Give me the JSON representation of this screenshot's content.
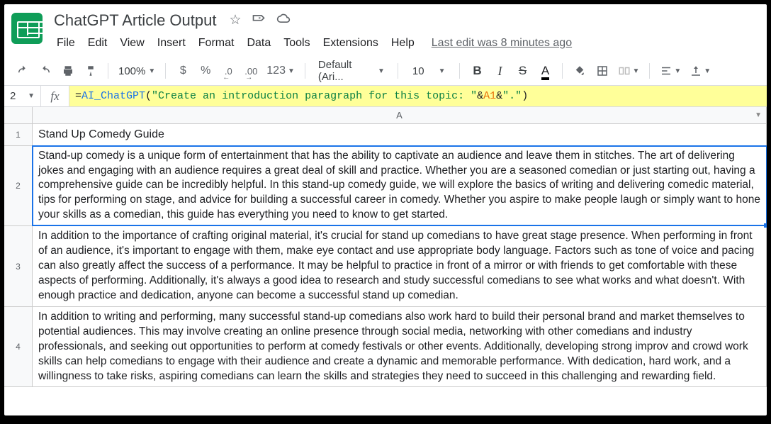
{
  "doc": {
    "title": "ChatGPT Article Output",
    "last_edit": "Last edit was 8 minutes ago"
  },
  "menu": {
    "file": "File",
    "edit": "Edit",
    "view": "View",
    "insert": "Insert",
    "format": "Format",
    "data": "Data",
    "tools": "Tools",
    "extensions": "Extensions",
    "help": "Help"
  },
  "toolbar": {
    "zoom": "100%",
    "currency": "$",
    "percent": "%",
    "dec_dec": ".0",
    "dec_inc": ".00",
    "more_formats": "123",
    "font": "Default (Ari...",
    "font_size": "10",
    "bold": "B",
    "italic": "I",
    "strike": "S",
    "text_color": "A"
  },
  "formula": {
    "name_box": "2",
    "fx": "fx",
    "eq": "=",
    "func": "AI_ChatGPT",
    "open": "(",
    "str1": "\"Create an introduction paragraph for this topic: \"",
    "amp1": "&",
    "ref": "A1",
    "amp2": "&",
    "str2": "\".\"",
    "close": ")"
  },
  "sheet": {
    "col_a": "A",
    "rows": {
      "r1": "1",
      "r2": "2",
      "r3": "3",
      "r4": "4"
    },
    "cells": {
      "a1": "Stand Up Comedy Guide",
      "a2": "Stand-up comedy is a unique form of entertainment that has the ability to captivate an audience and leave them in stitches. The art of delivering jokes and engaging with an audience requires a great deal of skill and practice. Whether you are a seasoned comedian or just starting out, having a comprehensive guide can be incredibly helpful. In this stand-up comedy guide, we will explore the basics of writing and delivering comedic material, tips for performing on stage, and advice for building a successful career in comedy. Whether you aspire to make people laugh or simply want to hone your skills as a comedian, this guide has everything you need to know to get started.",
      "a3": "In addition to the importance of crafting original material, it's crucial for stand up comedians to have great stage presence. When performing in front of an audience, it's important to engage with them, make eye contact and use appropriate body language. Factors such as tone of voice and pacing can also greatly affect the success of a performance. It may be helpful to practice in front of a mirror or with friends to get comfortable with these aspects of performing. Additionally, it's always a good idea to research and study successful comedians to see what works and what doesn't. With enough practice and dedication, anyone can become a successful stand up comedian.",
      "a4": "In addition to writing and performing, many successful stand-up comedians also work hard to build their personal brand and market themselves to potential audiences. This may involve creating an online presence through social media, networking with other comedians and industry professionals, and seeking out opportunities to perform at comedy festivals or other events. Additionally, developing strong improv and crowd work skills can help comedians to engage with their audience and create a dynamic and memorable performance. With dedication, hard work, and a willingness to take risks, aspiring comedians can learn the skills and strategies they need to succeed in this challenging and rewarding field."
    }
  }
}
